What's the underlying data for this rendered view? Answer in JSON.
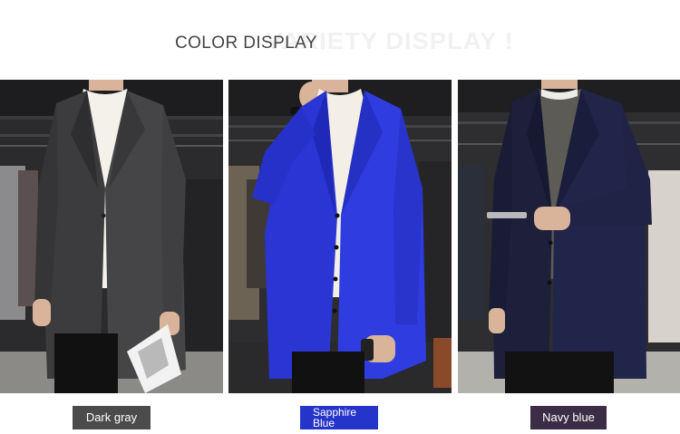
{
  "header": {
    "title": "COLOR DISPLAY",
    "ghost_text": "VARIETY DISPLAY !"
  },
  "swatches": [
    {
      "label": "Dark gray",
      "color": "#4b4b4b",
      "coat_color": "#3c3c3e"
    },
    {
      "label_line1": "Sapphire",
      "label_line2": "Blue",
      "color": "#2635c9",
      "coat_color": "#2a35d3"
    },
    {
      "label": "Navy blue",
      "color": "#3a2d45",
      "coat_color": "#1f2140"
    }
  ]
}
